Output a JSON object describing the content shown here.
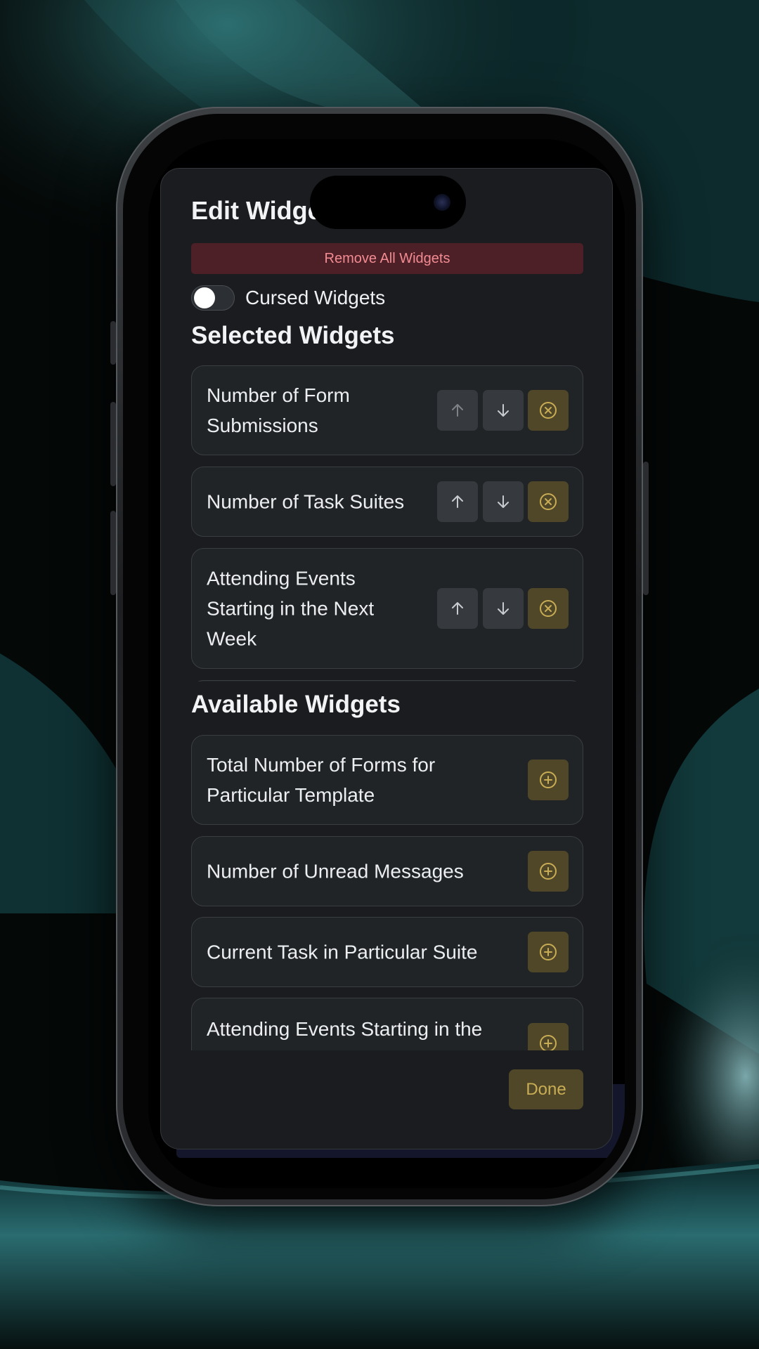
{
  "modal": {
    "title": "Edit Widgets",
    "remove_all_label": "Remove All Widgets",
    "cursed_toggle": {
      "label": "Cursed Widgets",
      "on": false
    },
    "selected_title": "Selected Widgets",
    "available_title": "Available Widgets",
    "done_label": "Done"
  },
  "selected_widgets": [
    {
      "line1": "Number of Form",
      "line2": "Submissions",
      "line3": ""
    },
    {
      "line1": "Number of Task Suites",
      "line2": "",
      "line3": ""
    },
    {
      "line1": "Attending Events",
      "line2": "Starting in the Next",
      "line3": "Week"
    }
  ],
  "available_widgets": [
    {
      "line1": "Total Number of Forms for",
      "line2": "Particular Template"
    },
    {
      "line1": "Number of Unread Messages",
      "line2": ""
    },
    {
      "line1": "Current Task in Particular Suite",
      "line2": ""
    },
    {
      "line1": "Attending Events Starting in the",
      "line2": ""
    }
  ],
  "icons": {
    "move_up": "arrow-up-icon",
    "move_down": "arrow-down-icon",
    "remove": "circle-x-icon",
    "add": "circle-plus-icon"
  },
  "colors": {
    "remove_all_bg": "#4d1f26",
    "remove_all_text": "#f28b92",
    "accent_gold": "#c9ad55",
    "accent_gold_bg": "#4f4727",
    "modal_bg": "#1a1c1f"
  }
}
